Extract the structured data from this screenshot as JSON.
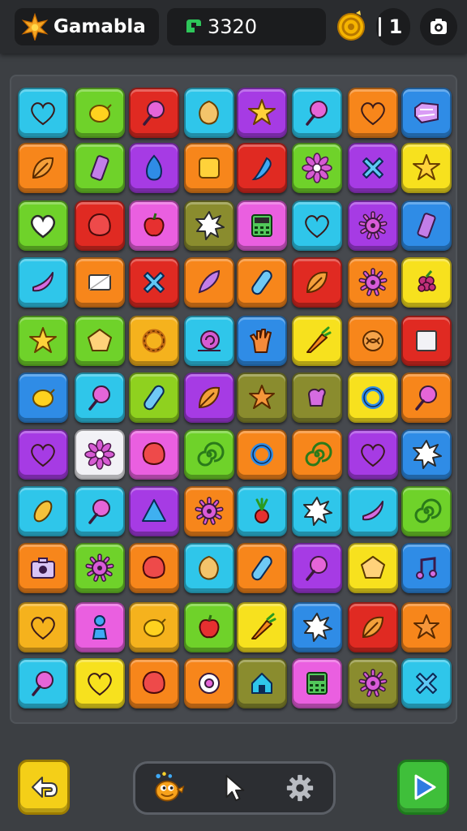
{
  "header": {
    "app_title": "Gamabla",
    "score": "3320",
    "level": "1"
  },
  "colors": {
    "cyan": "#2fc6ea",
    "green": "#6fd22a",
    "red": "#e02a22",
    "orange": "#f7861b",
    "purple": "#a63be4",
    "blue": "#2f8ce6",
    "yellow": "#f7e11e",
    "pink": "#ea5fe0",
    "olive": "#8a8c2e",
    "lime": "#8fd11f",
    "amber": "#f5b21d",
    "white": "#f2f2f6"
  },
  "board": {
    "rows": [
      [
        {
          "c": "cyan",
          "i": "heart"
        },
        {
          "c": "green",
          "i": "lemon"
        },
        {
          "c": "red",
          "i": "lollipop"
        },
        {
          "c": "cyan",
          "i": "nut"
        },
        {
          "c": "purple",
          "i": "star"
        },
        {
          "c": "cyan",
          "i": "lollipop"
        },
        {
          "c": "orange",
          "i": "heart"
        },
        {
          "c": "blue",
          "i": "gem"
        }
      ],
      [
        {
          "c": "orange",
          "i": "leaf"
        },
        {
          "c": "green",
          "i": "bar"
        },
        {
          "c": "purple",
          "i": "drop"
        },
        {
          "c": "orange",
          "i": "square"
        },
        {
          "c": "red",
          "i": "chili"
        },
        {
          "c": "green",
          "i": "flower"
        },
        {
          "c": "purple",
          "i": "cross"
        },
        {
          "c": "yellow",
          "i": "star"
        }
      ],
      [
        {
          "c": "green",
          "i": "heart-outline"
        },
        {
          "c": "red",
          "i": "blob"
        },
        {
          "c": "pink",
          "i": "apple"
        },
        {
          "c": "olive",
          "i": "burst"
        },
        {
          "c": "pink",
          "i": "calculator"
        },
        {
          "c": "cyan",
          "i": "heart"
        },
        {
          "c": "purple",
          "i": "sun"
        },
        {
          "c": "blue",
          "i": "bar"
        }
      ],
      [
        {
          "c": "cyan",
          "i": "banana"
        },
        {
          "c": "orange",
          "i": "envelope"
        },
        {
          "c": "red",
          "i": "cross"
        },
        {
          "c": "orange",
          "i": "feather"
        },
        {
          "c": "orange",
          "i": "pill"
        },
        {
          "c": "red",
          "i": "leaf"
        },
        {
          "c": "orange",
          "i": "sun"
        },
        {
          "c": "yellow",
          "i": "grape"
        }
      ],
      [
        {
          "c": "green",
          "i": "star"
        },
        {
          "c": "green",
          "i": "pentagon"
        },
        {
          "c": "amber",
          "i": "wreath"
        },
        {
          "c": "cyan",
          "i": "snail"
        },
        {
          "c": "blue",
          "i": "hand"
        },
        {
          "c": "yellow",
          "i": "carrot"
        },
        {
          "c": "orange",
          "i": "knot"
        },
        {
          "c": "red",
          "i": "square-white"
        }
      ],
      [
        {
          "c": "blue",
          "i": "lemon"
        },
        {
          "c": "cyan",
          "i": "lollipop"
        },
        {
          "c": "lime",
          "i": "pill"
        },
        {
          "c": "purple",
          "i": "leaf"
        },
        {
          "c": "olive",
          "i": "starfish"
        },
        {
          "c": "olive",
          "i": "mitten"
        },
        {
          "c": "yellow",
          "i": "ring"
        },
        {
          "c": "orange",
          "i": "lollipop"
        }
      ],
      [
        {
          "c": "purple",
          "i": "heart"
        },
        {
          "c": "white",
          "i": "flower"
        },
        {
          "c": "pink",
          "i": "blob"
        },
        {
          "c": "green",
          "i": "spiral"
        },
        {
          "c": "orange",
          "i": "ring"
        },
        {
          "c": "orange",
          "i": "spiral"
        },
        {
          "c": "purple",
          "i": "heart"
        },
        {
          "c": "blue",
          "i": "burst"
        }
      ],
      [
        {
          "c": "cyan",
          "i": "bean"
        },
        {
          "c": "cyan",
          "i": "lollipop"
        },
        {
          "c": "purple",
          "i": "triangle"
        },
        {
          "c": "orange",
          "i": "sun"
        },
        {
          "c": "cyan",
          "i": "radish"
        },
        {
          "c": "cyan",
          "i": "burst"
        },
        {
          "c": "cyan",
          "i": "banana"
        },
        {
          "c": "green",
          "i": "spiral"
        }
      ],
      [
        {
          "c": "orange",
          "i": "camera"
        },
        {
          "c": "green",
          "i": "sun"
        },
        {
          "c": "orange",
          "i": "blob"
        },
        {
          "c": "cyan",
          "i": "nut"
        },
        {
          "c": "orange",
          "i": "pill"
        },
        {
          "c": "purple",
          "i": "lollipop"
        },
        {
          "c": "yellow",
          "i": "pentagon"
        },
        {
          "c": "blue",
          "i": "music"
        }
      ],
      [
        {
          "c": "amber",
          "i": "heart"
        },
        {
          "c": "pink",
          "i": "pawn"
        },
        {
          "c": "amber",
          "i": "lemon"
        },
        {
          "c": "green",
          "i": "apple"
        },
        {
          "c": "yellow",
          "i": "carrot"
        },
        {
          "c": "blue",
          "i": "burst"
        },
        {
          "c": "red",
          "i": "leaf"
        },
        {
          "c": "orange",
          "i": "starfish"
        }
      ],
      [
        {
          "c": "cyan",
          "i": "lollipop"
        },
        {
          "c": "yellow",
          "i": "heart"
        },
        {
          "c": "orange",
          "i": "blob"
        },
        {
          "c": "orange",
          "i": "donut"
        },
        {
          "c": "olive",
          "i": "house"
        },
        {
          "c": "pink",
          "i": "calculator"
        },
        {
          "c": "olive",
          "i": "sun"
        },
        {
          "c": "cyan",
          "i": "cross"
        }
      ]
    ]
  },
  "icons": {
    "brand": "star-icon",
    "score": "gem-icon",
    "coin": "coin-icon",
    "camera": "camera-icon",
    "back": "back-arrow-icon",
    "mascot": "bird-mascot-icon",
    "pointer": "cursor-icon",
    "settings": "gear-icon",
    "play": "play-icon"
  }
}
